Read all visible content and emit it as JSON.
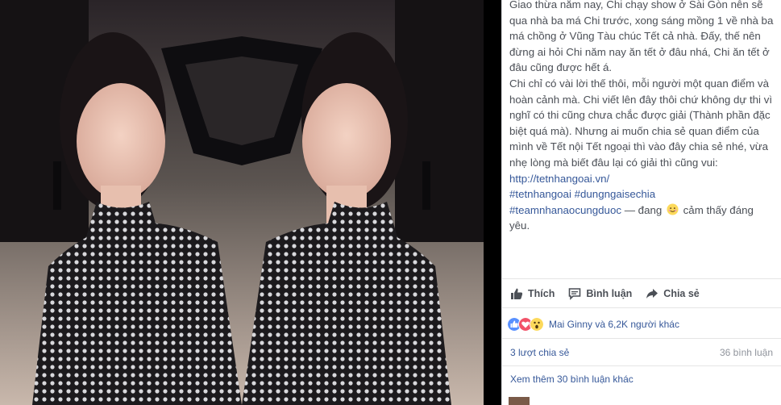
{
  "caption": {
    "line1": "Giao thừa năm nay, Chi chạy show ở Sài Gòn nên sẽ qua nhà ba má Chi trước, xong sáng mồng 1 về nhà ba má chồng ở Vũng Tàu chúc Tết cả nhà. Đấy, thế nên đừng ai hỏi Chi năm nay ăn tết ở đâu nhá, Chi ăn tết ở đâu cũng được hết á.",
    "line2": "Chi chỉ có vài lời thế thôi, mỗi người một quan điểm và hoàn cảnh mà. Chi viết lên đây thôi chứ không dự thi vì nghĩ có thi cũng chưa chắc được giải (Thành phần đặc biệt quá mà). Nhưng ai muốn chia sẻ quan điểm của mình về Tết nội Tết ngoại thì vào đây chia sẻ nhé, vừa nhẹ lòng mà biết đâu lại có giải thì cũng vui: ",
    "link": "http://tetnhangoai.vn/",
    "tag1": "#tetnhangoai",
    "tag2": "#dungngaisechia",
    "tag3": "#teamnhanaocungduoc",
    "feeling_prefix": " — đang ",
    "feeling_text": " cảm thấy đáng yêu."
  },
  "actions": {
    "like": "Thích",
    "comment": "Bình luận",
    "share": "Chia sẻ"
  },
  "reactions": {
    "text": "Mai Ginny và 6,2K người khác"
  },
  "stats": {
    "shares": "3 lượt chia sẻ",
    "comments": "36 bình luận"
  },
  "more_comments": "Xem thêm 30 bình luận khác",
  "colors": {
    "link": "#365899",
    "text": "#4b4f56",
    "muted": "#90949c",
    "like_blue": "#5890ff",
    "love_red": "#f25268",
    "wow_yellow": "#fcd95b"
  }
}
